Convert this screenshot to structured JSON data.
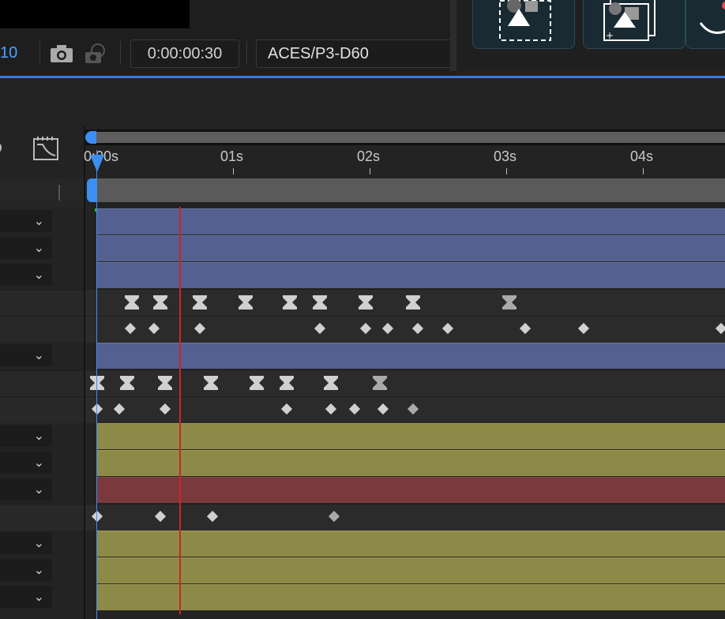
{
  "viewer": {
    "zoom_fragment": "10",
    "timecode": "0:00:00:30",
    "color_space": "ACES/P3-D60"
  },
  "icons": {
    "camera": "camera-icon",
    "visibility": "show-snapshot-icon",
    "graph": "graph-editor-icon",
    "search": "search-icon"
  },
  "ruler": {
    "labels": [
      "0:00s",
      "01s",
      "02s",
      "03s",
      "04s"
    ]
  },
  "colors": {
    "playhead": "#3d8ef0",
    "current_time_marker": "#d02525",
    "purple_layer": "#54608f",
    "olive_layer": "#8d8a47",
    "red_layer": "#7a3a3d"
  }
}
